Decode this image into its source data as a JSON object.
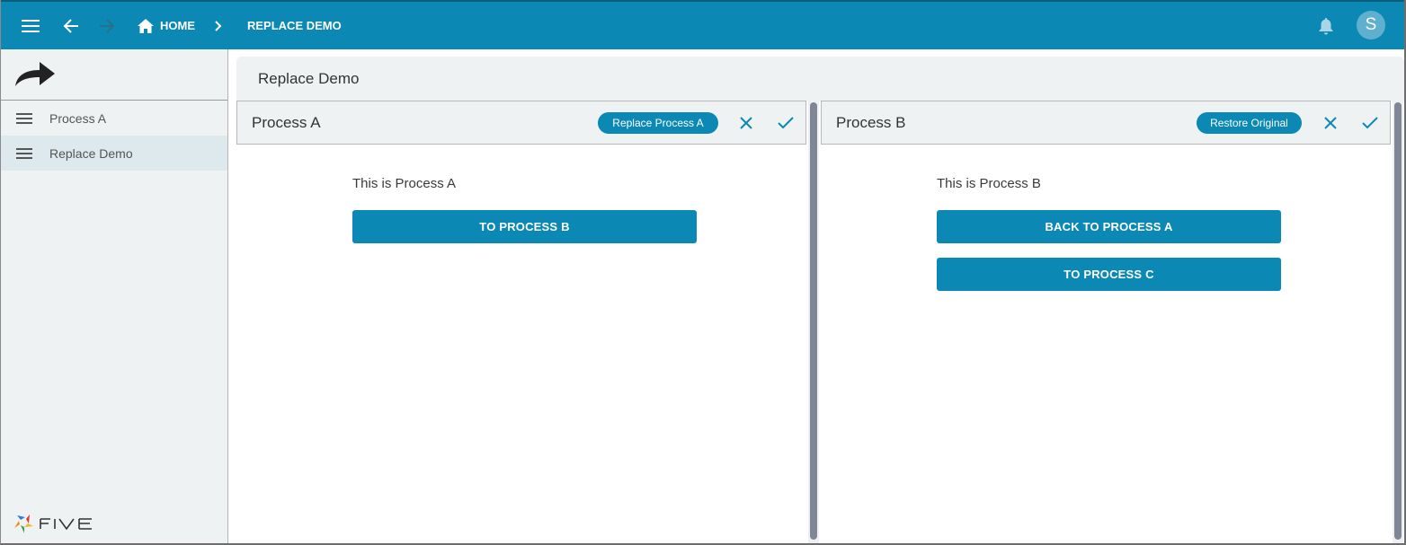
{
  "topbar": {
    "menu_icon": "hamburger-menu-icon",
    "back_icon": "arrow-left-icon",
    "forward_icon": "arrow-right-icon",
    "breadcrumb": {
      "home_label": "HOME",
      "separator_icon": "chevron-right-icon",
      "current_label": "REPLACE DEMO"
    },
    "notification_icon": "bell-icon",
    "avatar_initial": "S",
    "colors": {
      "bar": "#0b88b4",
      "forward_disabled": "#2a6f8c"
    }
  },
  "sidebar": {
    "logo_icon": "share-arrow-icon",
    "items": [
      {
        "label": "Process A",
        "icon": "menu-lines-icon",
        "active": false
      },
      {
        "label": "Replace Demo",
        "icon": "menu-lines-icon",
        "active": true
      }
    ],
    "footer_brand": "FIVE"
  },
  "main": {
    "page_title": "Replace Demo",
    "panels": [
      {
        "title": "Process A",
        "action_pill": "Replace Process A",
        "cancel_icon": "close-icon",
        "confirm_icon": "check-icon",
        "description": "This is Process A",
        "buttons": [
          "TO PROCESS B"
        ]
      },
      {
        "title": "Process B",
        "action_pill": "Restore Original",
        "cancel_icon": "close-icon",
        "confirm_icon": "check-icon",
        "description": "This is Process B",
        "buttons": [
          "BACK TO PROCESS A",
          "TO PROCESS C"
        ]
      }
    ],
    "accent_color": "#0b88b4"
  }
}
